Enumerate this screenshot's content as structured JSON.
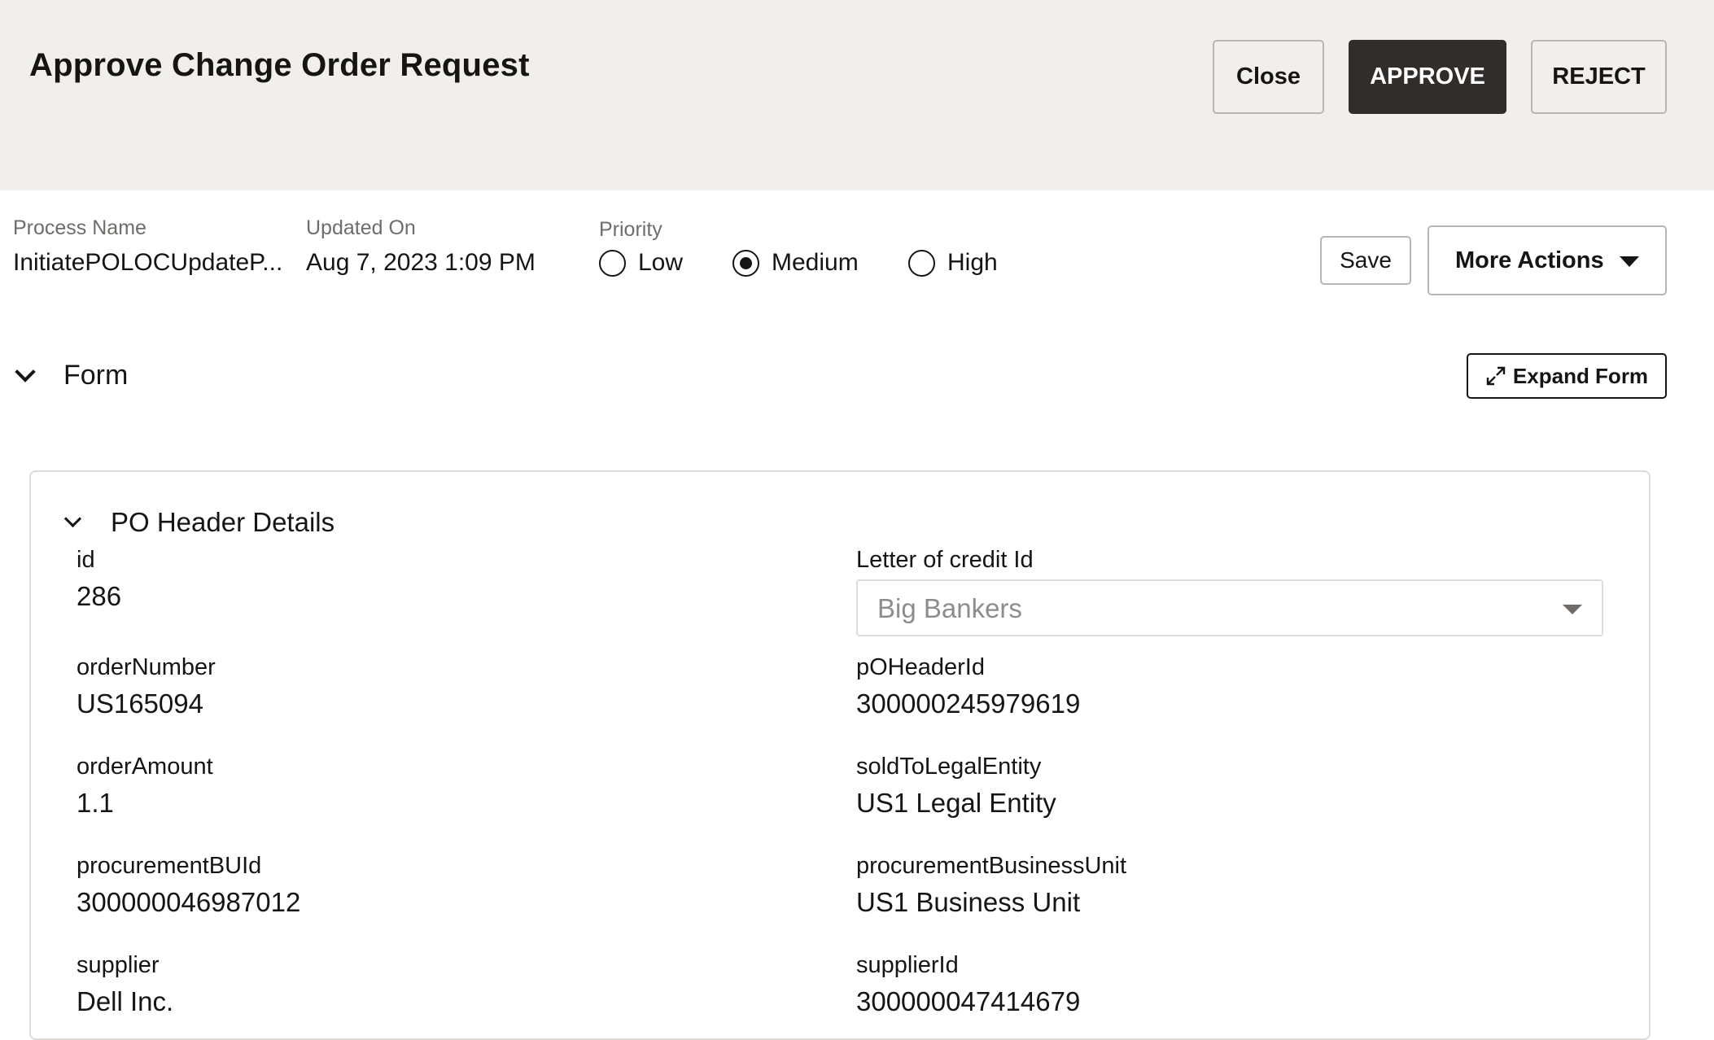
{
  "header": {
    "title": "Approve Change Order Request",
    "close_label": "Close",
    "approve_label": "APPROVE",
    "reject_label": "REJECT"
  },
  "info": {
    "process_name_label": "Process Name",
    "process_name_value": "InitiatePOLOCUpdateP...",
    "updated_on_label": "Updated On",
    "updated_on_value": "Aug 7, 2023 1:09 PM",
    "priority_label": "Priority",
    "priority_options": [
      "Low",
      "Medium",
      "High"
    ],
    "priority_selected": "Medium",
    "save_label": "Save",
    "more_actions_label": "More Actions"
  },
  "form": {
    "title": "Form",
    "expand_label": "Expand Form",
    "section_title": "PO Header Details",
    "fields": {
      "id": {
        "label": "id",
        "value": "286"
      },
      "letter_of_credit": {
        "label": "Letter of credit Id",
        "value": "Big Bankers"
      },
      "order_number": {
        "label": "orderNumber",
        "value": "US165094"
      },
      "po_header_id": {
        "label": "pOHeaderId",
        "value": "300000245979619"
      },
      "order_amount": {
        "label": "orderAmount",
        "value": "1.1"
      },
      "sold_to_legal_entity": {
        "label": "soldToLegalEntity",
        "value": "US1 Legal Entity"
      },
      "procurement_bu_id": {
        "label": "procurementBUId",
        "value": "300000046987012"
      },
      "procurement_business_unit": {
        "label": "procurementBusinessUnit",
        "value": "US1 Business Unit"
      },
      "supplier": {
        "label": "supplier",
        "value": "Dell Inc."
      },
      "supplier_id": {
        "label": "supplierId",
        "value": "300000047414679"
      }
    }
  },
  "colors": {
    "header_bg": "#f1efed",
    "primary_button": "#312d2a",
    "border": "#b9b6b2",
    "muted_text": "#6f6c69"
  },
  "icons": {
    "expand": "expand-arrows-icon",
    "caret": "caret-down-icon",
    "chevron": "chevron-down-icon"
  }
}
